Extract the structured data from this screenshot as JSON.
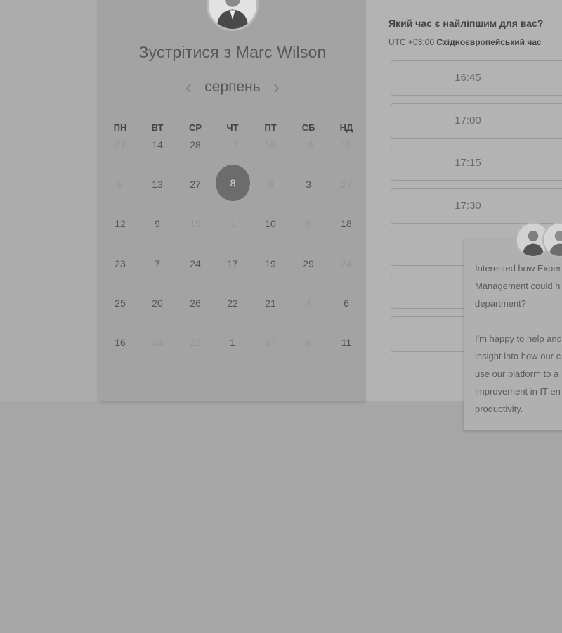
{
  "host": {
    "title": "Зустрітися з Marc Wilson",
    "avatar": "host-avatar"
  },
  "calendar": {
    "month": "серпень",
    "prev_icon": "chevron-left-icon",
    "next_icon": "chevron-right-icon",
    "weekdays": [
      "ПН",
      "ВТ",
      "СР",
      "ЧТ",
      "ПТ",
      "СБ",
      "НД"
    ],
    "selected_day": "8",
    "weeks": [
      [
        {
          "t": "27",
          "s": "d"
        },
        {
          "t": "14",
          "s": "a"
        },
        {
          "t": "28",
          "s": "a"
        },
        {
          "t": "17",
          "s": "d"
        },
        {
          "t": "15",
          "s": "d"
        },
        {
          "t": "15",
          "s": "d"
        },
        {
          "t": "15",
          "s": "d"
        }
      ],
      [
        {
          "t": "8",
          "s": "d"
        },
        {
          "t": "13",
          "s": "a"
        },
        {
          "t": "27",
          "s": "a"
        },
        {
          "t": "8",
          "s": "sel"
        },
        {
          "t": "9",
          "s": "d"
        },
        {
          "t": "3",
          "s": "a"
        },
        {
          "t": "27",
          "s": "d"
        }
      ],
      [
        {
          "t": "12",
          "s": "a"
        },
        {
          "t": "9",
          "s": "a"
        },
        {
          "t": "19",
          "s": "d"
        },
        {
          "t": "1",
          "s": "d"
        },
        {
          "t": "10",
          "s": "a"
        },
        {
          "t": "6",
          "s": "d"
        },
        {
          "t": "18",
          "s": "a"
        }
      ],
      [
        {
          "t": "23",
          "s": "a"
        },
        {
          "t": "7",
          "s": "a"
        },
        {
          "t": "24",
          "s": "a"
        },
        {
          "t": "17",
          "s": "a"
        },
        {
          "t": "19",
          "s": "a"
        },
        {
          "t": "29",
          "s": "a"
        },
        {
          "t": "24",
          "s": "d"
        }
      ],
      [
        {
          "t": "25",
          "s": "a"
        },
        {
          "t": "20",
          "s": "a"
        },
        {
          "t": "26",
          "s": "a"
        },
        {
          "t": "22",
          "s": "a"
        },
        {
          "t": "21",
          "s": "a"
        },
        {
          "t": "4",
          "s": "d"
        },
        {
          "t": "6",
          "s": "a"
        }
      ],
      [
        {
          "t": "16",
          "s": "a"
        },
        {
          "t": "24",
          "s": "d"
        },
        {
          "t": "23",
          "s": "d"
        },
        {
          "t": "1",
          "s": "a"
        },
        {
          "t": "27",
          "s": "d"
        },
        {
          "t": "8",
          "s": "d"
        },
        {
          "t": "11",
          "s": "a"
        }
      ]
    ]
  },
  "times": {
    "question": "Який час є найліпшим для вас?",
    "tz_offset": "UTC +03:00",
    "tz_name": "Східноєвропейський час",
    "slots": [
      "16:45",
      "17:00",
      "17:15",
      "17:30",
      "",
      "",
      "",
      ""
    ]
  },
  "chat": {
    "lines": [
      "Interested how Exper",
      "Management could h",
      "department?",
      "",
      "I'm happy to help and",
      "insight into how our c",
      "use our platform to a",
      "improvement in IT en",
      "productivity."
    ],
    "avatars": [
      "agent-avatar",
      "agent-avatar"
    ]
  }
}
